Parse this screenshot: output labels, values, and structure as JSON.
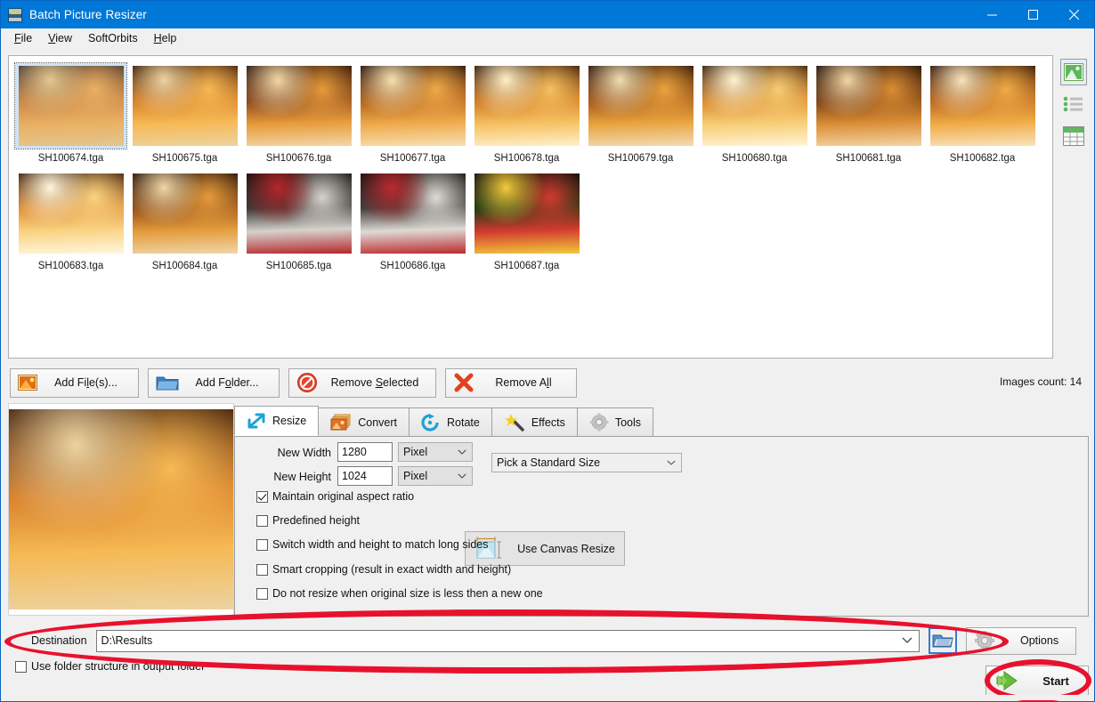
{
  "window": {
    "title": "Batch Picture Resizer",
    "icon": "app-window-icon",
    "controls": {
      "minimize": "minimize-icon",
      "maximize": "maximize-icon",
      "close": "close-icon"
    },
    "accent": "#0078d7"
  },
  "menubar": {
    "items": [
      {
        "label": "File",
        "mnemonic": "F"
      },
      {
        "label": "View",
        "mnemonic": "V"
      },
      {
        "label": "SoftOrbits",
        "mnemonic": ""
      },
      {
        "label": "Help",
        "mnemonic": "H"
      }
    ]
  },
  "thumbnails": {
    "items": [
      {
        "name": "SH100674.tga",
        "selected": true
      },
      {
        "name": "SH100675.tga",
        "selected": false
      },
      {
        "name": "SH100676.tga",
        "selected": false
      },
      {
        "name": "SH100677.tga",
        "selected": false
      },
      {
        "name": "SH100678.tga",
        "selected": false
      },
      {
        "name": "SH100679.tga",
        "selected": false
      },
      {
        "name": "SH100680.tga",
        "selected": false
      },
      {
        "name": "SH100681.tga",
        "selected": false
      },
      {
        "name": "SH100682.tga",
        "selected": false
      },
      {
        "name": "SH100683.tga",
        "selected": false
      },
      {
        "name": "SH100684.tga",
        "selected": false
      },
      {
        "name": "SH100685.tga",
        "selected": false
      },
      {
        "name": "SH100686.tga",
        "selected": false
      },
      {
        "name": "SH100687.tga",
        "selected": false
      }
    ]
  },
  "view_modes": [
    {
      "name": "thumbnail-view",
      "icon": "picture-icon",
      "active": true
    },
    {
      "name": "list-view",
      "icon": "list-icon",
      "active": false
    },
    {
      "name": "details-view",
      "icon": "table-icon",
      "active": false
    }
  ],
  "file_toolbar": {
    "add_files": "Add File(s)...",
    "add_folder": "Add Folder...",
    "remove_selected": "Remove Selected",
    "remove_all": "Remove All",
    "images_count": "Images count: 14"
  },
  "tabs": [
    {
      "label": "Resize",
      "icon": "resize-arrows-icon",
      "active": true
    },
    {
      "label": "Convert",
      "icon": "convert-images-icon",
      "active": false
    },
    {
      "label": "Rotate",
      "icon": "rotate-arrow-icon",
      "active": false
    },
    {
      "label": "Effects",
      "icon": "magic-wand-icon",
      "active": false
    },
    {
      "label": "Tools",
      "icon": "gear-icon",
      "active": false
    }
  ],
  "resize_panel": {
    "new_width_label": "New Width",
    "new_width_value": "1280",
    "new_width_unit": "Pixel",
    "new_height_label": "New Height",
    "new_height_value": "1024",
    "new_height_unit": "Pixel",
    "standard_size_value": "Pick a Standard Size",
    "canvas_resize_label": "Use Canvas Resize",
    "checkboxes": [
      {
        "label": "Maintain original aspect ratio",
        "checked": true
      },
      {
        "label": "Predefined height",
        "checked": false
      },
      {
        "label": "Switch width and height to match long sides",
        "checked": false
      },
      {
        "label": "Smart cropping (result in exact width and height)",
        "checked": false
      },
      {
        "label": "Do not resize when original size is less then a new one",
        "checked": false
      }
    ]
  },
  "destination": {
    "label": "Destination",
    "value": "D:\\Results",
    "browse_icon": "folder-browse-icon",
    "options_label": "Options",
    "options_icon": "gear-icon",
    "use_folder_structure_label": "Use folder structure in output folder",
    "use_folder_structure_checked": false
  },
  "start": {
    "label": "Start",
    "icon": "green-play-arrow-icon"
  },
  "annotations": {
    "highlight_color": "#e8112d",
    "shapes": [
      {
        "name": "destination-row-highlight",
        "type": "ellipse"
      },
      {
        "name": "start-button-highlight",
        "type": "ellipse"
      }
    ]
  }
}
